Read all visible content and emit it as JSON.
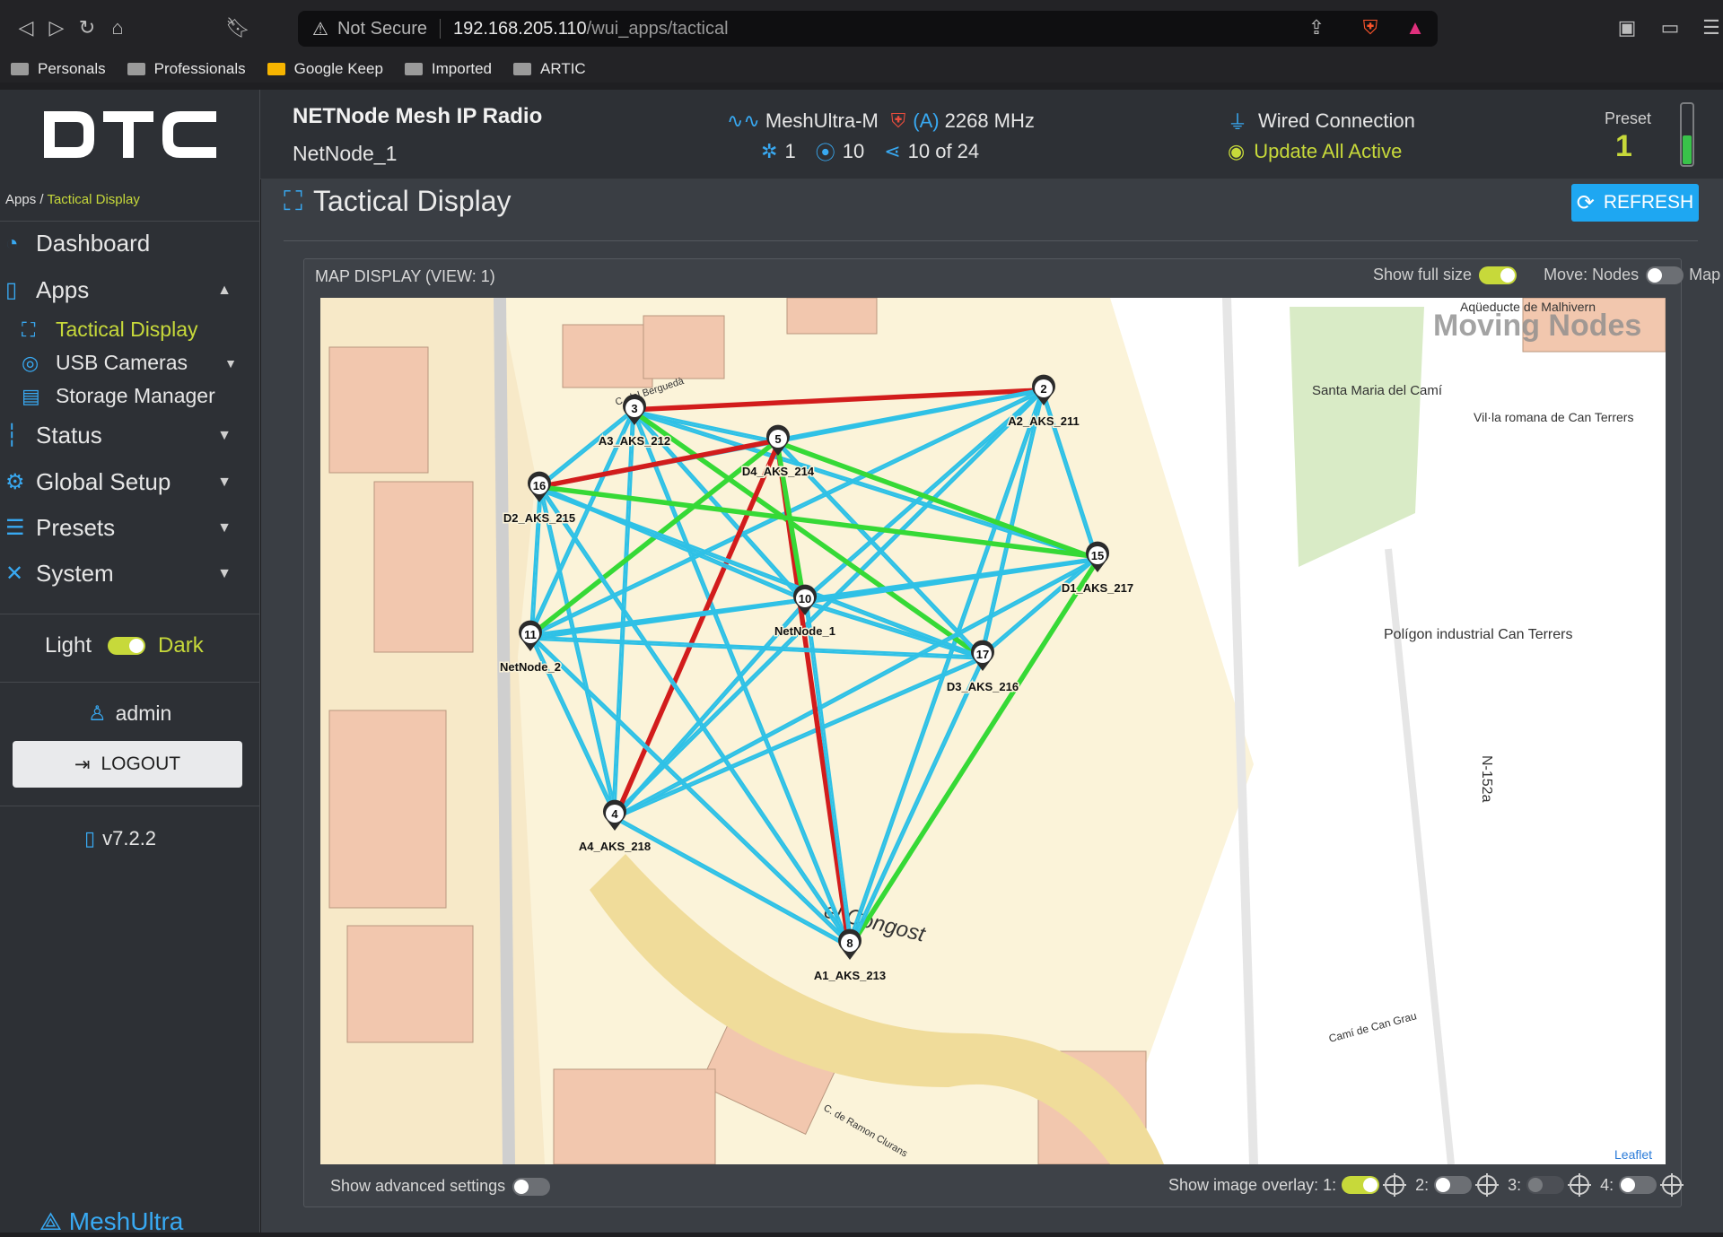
{
  "browser": {
    "not_secure": "Not Secure",
    "url_host": "192.168.205.110",
    "url_path": "/wui_apps/tactical",
    "bookmarks": [
      "Personals",
      "Professionals",
      "Google Keep",
      "Imported",
      "ARTIC"
    ]
  },
  "header": {
    "brand": "DTC",
    "product": "NETNode Mesh IP Radio",
    "node_name": "NetNode_1",
    "waveform": "MeshUltra-M",
    "frequency": "2268 MHz",
    "mesh_count": "1",
    "node_count": "10",
    "links": "10 of 24",
    "connection": "Wired Connection",
    "update_mode": "Update All Active",
    "preset_label": "Preset",
    "preset_value": "1"
  },
  "breadcrumb": {
    "root": "Apps",
    "sep": "/",
    "current": "Tactical Display"
  },
  "sidebar": {
    "dashboard": "Dashboard",
    "apps": "Apps",
    "tactical": "Tactical Display",
    "usb": "USB Cameras",
    "storage": "Storage Manager",
    "status": "Status",
    "global": "Global Setup",
    "presets": "Presets",
    "system": "System",
    "light": "Light",
    "dark": "Dark",
    "user": "admin",
    "logout": "LOGOUT",
    "version": "v7.2.2",
    "footer_brand": "MeshUltra"
  },
  "page": {
    "title": "Tactical Display",
    "refresh": "REFRESH",
    "panel_label": "MAP DISPLAY (VIEW: 1)",
    "show_full_size": "Show full size",
    "move_nodes": "Move: Nodes",
    "move_map": "Map",
    "advanced": "Show advanced settings",
    "overlay_1": "Show image overlay: 1:",
    "overlay_2": "2:",
    "overlay_3": "3:",
    "overlay_4": "4:",
    "moving_nodes": "Moving Nodes",
    "leaflet": "Leaflet"
  },
  "colors": {
    "accent_yellow": "#c7d93a",
    "accent_blue": "#38a9f2",
    "link_good": "#2fc1e6",
    "link_medium": "#36d936",
    "link_bad": "#d21c1c"
  },
  "map_labels": {
    "street_1": "C. del Berguedà",
    "street_2": "C. de Ramon Clurans",
    "street_3": "Camí de Can Grau",
    "place_1": "Santa Maria del Camí",
    "place_2": "Aqüeducte de Malhivern",
    "place_3": "Vil·la romana de Can Terrers",
    "place_4": "Polígon industrial Can Terrers",
    "road": "N-152a",
    "river": "el Congost"
  },
  "nodes": [
    {
      "id": "2",
      "label": "A2_AKS_211"
    },
    {
      "id": "3",
      "label": "A3_AKS_212"
    },
    {
      "id": "5",
      "label": "D4_AKS_214"
    },
    {
      "id": "16",
      "label": "D2_AKS_215"
    },
    {
      "id": "15",
      "label": "D1_AKS_217"
    },
    {
      "id": "10",
      "label": "NetNode_1"
    },
    {
      "id": "11",
      "label": "NetNode_2"
    },
    {
      "id": "17",
      "label": "D3_AKS_216"
    },
    {
      "id": "4",
      "label": "A4_AKS_218"
    },
    {
      "id": "8",
      "label": "A1_AKS_213"
    }
  ]
}
